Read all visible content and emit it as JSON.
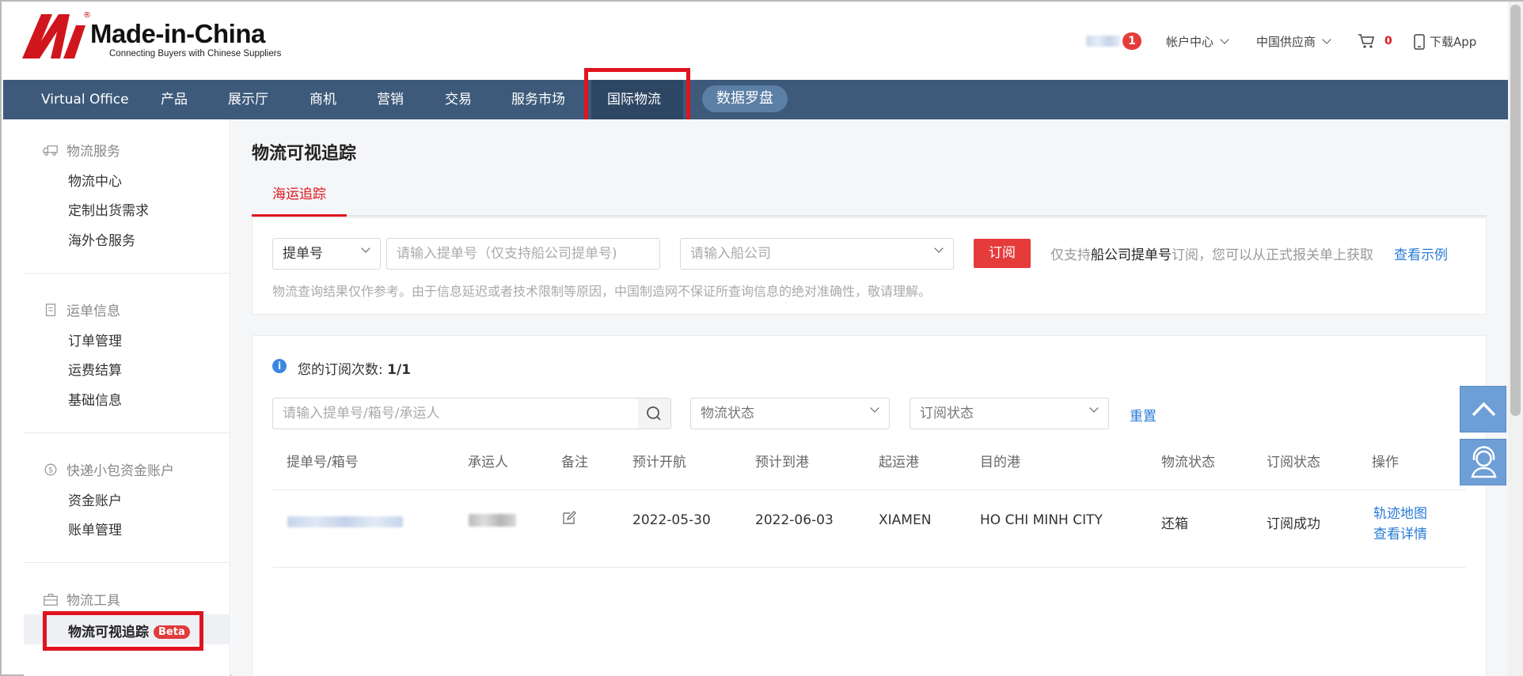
{
  "header": {
    "logo_name": "Made-in-China",
    "logo_tagline": "Connecting Buyers with Chinese Suppliers",
    "logo_reg": "®",
    "message_count": "1",
    "account_center": "帐户中心",
    "china_supplier": "中国供应商",
    "cart_count": "0",
    "download_app": "下载App"
  },
  "nav": {
    "items": [
      "Virtual Office",
      "产品",
      "展示厅",
      "商机",
      "营销",
      "交易",
      "服务市场",
      "国际物流"
    ],
    "data_compass": "数据罗盘",
    "active": "国际物流"
  },
  "sidebar": {
    "sections": [
      {
        "title": "物流服务",
        "icon": "truck-icon",
        "items": [
          "物流中心",
          "定制出货需求",
          "海外仓服务"
        ]
      },
      {
        "title": "运单信息",
        "icon": "document-icon",
        "items": [
          "订单管理",
          "运费结算",
          "基础信息"
        ]
      },
      {
        "title": "快递小包资金账户",
        "icon": "dollar-icon",
        "items": [
          "资金账户",
          "账单管理"
        ]
      },
      {
        "title": "物流工具",
        "icon": "toolbox-icon",
        "items": [
          "物流可视追踪"
        ]
      }
    ],
    "active_item": "物流可视追踪",
    "beta_label": "Beta"
  },
  "main": {
    "title": "物流可视追踪",
    "tab": "海运追踪",
    "subscribe_form": {
      "type_select": "提单号",
      "bl_placeholder": "请输入提单号（仅支持船公司提单号)",
      "carrier_placeholder": "请输入船公司",
      "subscribe_button": "订阅",
      "hint_prefix": "仅支持",
      "hint_bold": "船公司提单号",
      "hint_suffix": "订阅，您可以从正式报关单上获取",
      "example_link": "查看示例",
      "disclaimer": "物流查询结果仅作参考。由于信息延迟或者技术限制等原因，中国制造网不保证所查询信息的绝对准确性，敬请理解。"
    },
    "subscription": {
      "label": "您的订阅次数:",
      "value": "1/1"
    },
    "filters": {
      "search_placeholder": "请输入提单号/箱号/承运人",
      "logistics_status": "物流状态",
      "subscribe_status": "订阅状态",
      "reset": "重置"
    },
    "table": {
      "headers": [
        "提单号/箱号",
        "承运人",
        "备注",
        "预计开航",
        "预计到港",
        "起运港",
        "目的港",
        "物流状态",
        "订阅状态",
        "操作"
      ],
      "rows": [
        {
          "etd": "2022-05-30",
          "eta": "2022-06-03",
          "pol": "XIAMEN",
          "pod": "HO CHI MINH CITY",
          "logistics_status": "还箱",
          "subscribe_status": "订阅成功",
          "action_map": "轨迹地图",
          "action_detail": "查看详情"
        }
      ]
    }
  },
  "colors": {
    "nav_bg": "#3d5a7a",
    "accent_red": "#e0141e",
    "link_blue": "#2a7ad6"
  }
}
